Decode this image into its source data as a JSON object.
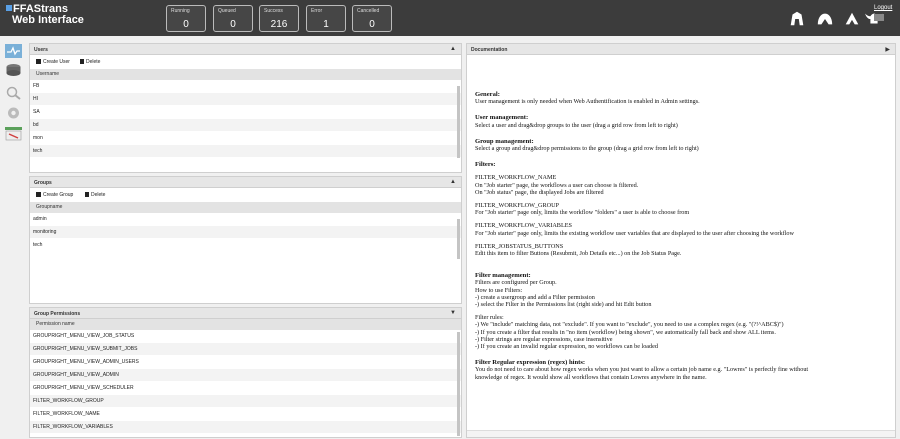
{
  "app": {
    "title_line1": "FFAStrans",
    "title_line2": "Web Interface",
    "logout_label": "Logout"
  },
  "counters": [
    {
      "label": "Running",
      "value": "0"
    },
    {
      "label": "Queued",
      "value": "0"
    },
    {
      "label": "Success",
      "value": "216"
    },
    {
      "label": "Error",
      "value": "1"
    },
    {
      "label": "Cancelled",
      "value": "0"
    }
  ],
  "top_icons": [
    "helmet-icon-1",
    "helmet-icon-2",
    "helmet-icon-3",
    "viking-helmet-icon"
  ],
  "sidenav": [
    "workflow-icon",
    "hard-drive-icon",
    "search-icon",
    "settings-icon",
    "user-admin-icon"
  ],
  "users_panel": {
    "title": "Users",
    "create_label": "Create User",
    "delete_label": "Delete",
    "column": "Username",
    "rows": [
      "FB",
      "HI",
      "SA",
      "bd",
      "mon",
      "tech"
    ]
  },
  "groups_panel": {
    "title": "Groups",
    "create_label": "Create Group",
    "delete_label": "Delete",
    "column": "Groupname",
    "rows": [
      "admin",
      "monitoring",
      "tech"
    ]
  },
  "permissions_panel": {
    "title": "Group Permissions",
    "column": "Permission name",
    "rows": [
      "GROUPRIGHT_MENU_VIEW_JOB_STATUS",
      "GROUPRIGHT_MENU_VIEW_SUBMIT_JOBS",
      "GROUPRIGHT_MENU_VIEW_ADMIN_USERS",
      "GROUPRIGHT_MENU_VIEW_ADMIN",
      "GROUPRIGHT_MENU_VIEW_SCHEDULER",
      "FILTER_WORKFLOW_GROUP",
      "FILTER_WORKFLOW_NAME",
      "FILTER_WORKFLOW_VARIABLES"
    ]
  },
  "doc_panel": {
    "title": "Documentation",
    "general_h": "General:",
    "general_p": "User management is only needed when Web Authentification is enabled in Admin settings.",
    "user_h": "User management:",
    "user_p": "Select a user and drag&drop groups to the user (drag a grid row from left to right)",
    "group_h": "Group management:",
    "group_p": "Select a group and drag&drop permissions to the group (drag a grid row from left to right)",
    "filters_h": "Filters:",
    "f1_name": "FILTER_WORKFLOW_NAME",
    "f1_p1": "On \"Job starter\" page, the workflows a user can choose is filtered.",
    "f1_p2": "On \"Job status\" page, the displayed Jobs are filtered",
    "f2_name": "FILTER_WORKFLOW_GROUP",
    "f2_p1": "For \"Job starter\" page only, limits the workflow \"folders\" a user is able to choose from",
    "f3_name": "FILTER_WORKFLOW_VARIABLES",
    "f3_p1": "For \"Job starter\" page only, limits the existing workflow user variables that are displayed to the user after choosing the workflow",
    "f4_name": "FILTER_JOBSTATUS_BUTTONS",
    "f4_p1": "Edit this item to filter Buttons (Resubmit, Job Details etc...) on the Job Status Page.",
    "fm_h": "Filter management:",
    "fm_p1": "Filters are configured per Group.",
    "fm_p2": "How to use Filters:",
    "fm_p3": "-) create a usergroup and add a Filter permission",
    "fm_p4": "-) select the Filter in the Permissions list (right side) and hit Edit button",
    "fr_p0": "Filter rules:",
    "fr_p1": "-) We \"include\" matching data, not \"exclude\". If you want to \"exclude\", you need to use a complex regex (e.g. \"(?!^ABC$)\")",
    "fr_p2": "-) If you create a filter that results in \"no item (workflow) being shown\", we automatically fall back and show ALL items.",
    "fr_p3": "-) Filter strings are regular expressions, case insensitive",
    "fr_p4": "-) If you create an invalid regular expression, no workflows can be loaded",
    "rx_h": "Filter Regular expression (regex) hints:",
    "rx_p1": "You do not need to care about how regex works when you just want to allow a certain job name e.g. \"Lowres\" is perfectly fine without",
    "rx_p2": "knowledge of regex. It would show all workflows that contain Lowres anywhere in the name."
  },
  "colors": {
    "topbar": "#3c3c3c",
    "panel_header": "#e6e6e6",
    "row_alt": "#f3f3f3"
  }
}
